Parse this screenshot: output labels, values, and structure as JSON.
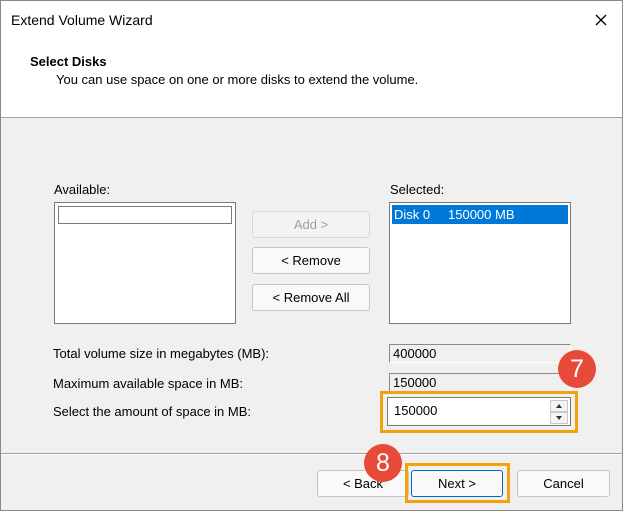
{
  "window": {
    "title": "Extend Volume Wizard"
  },
  "header": {
    "title": "Select Disks",
    "subtitle": "You can use space on one or more disks to extend the volume."
  },
  "available": {
    "label": "Available:"
  },
  "selected": {
    "label": "Selected:",
    "items": [
      {
        "disk": "Disk 0",
        "size": "150000 MB"
      }
    ]
  },
  "actions": {
    "add": "Add >",
    "remove": "< Remove",
    "remove_all": "< Remove All"
  },
  "fields": {
    "total_label": "Total volume size in megabytes (MB):",
    "total_value": "400000",
    "max_label": "Maximum available space in MB:",
    "max_value": "150000",
    "amount_label": "Select the amount of space in MB:",
    "amount_value": "150000"
  },
  "footer": {
    "back": "< Back",
    "next": "Next >",
    "cancel": "Cancel"
  },
  "annotations": {
    "badge_7": "7",
    "badge_8": "8",
    "highlight_color": "#f2a20c",
    "badge_color": "#e84a39"
  },
  "icons": {
    "close": "close-icon",
    "spin_up": "chevron-up-icon",
    "spin_down": "chevron-down-icon"
  }
}
